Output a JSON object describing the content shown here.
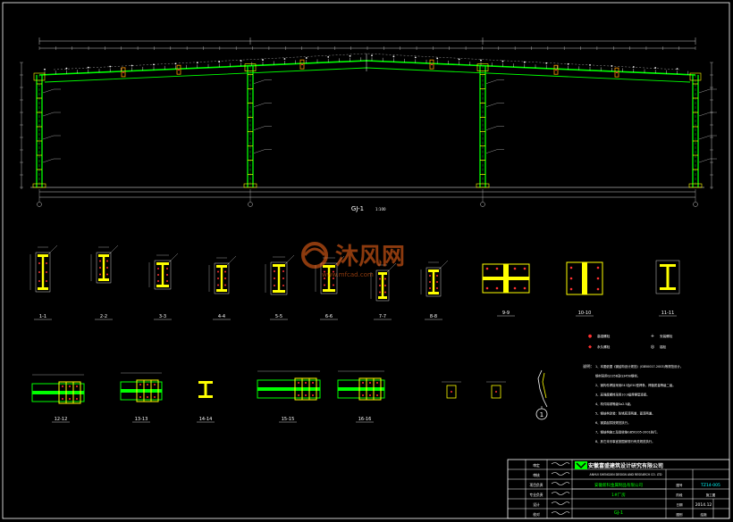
{
  "frame_title": "GJ-1",
  "frame_scale": "1:100",
  "section_labels": [
    "1-1",
    "2-2",
    "3-3",
    "4-4",
    "5-5",
    "6-6",
    "7-7",
    "8-8",
    "9-9",
    "10-10",
    "11-11",
    "12-12",
    "13-13",
    "14-14",
    "15-15",
    "16-16"
  ],
  "detail_callout": "1",
  "watermark": {
    "brand": "沐风网",
    "url": "www.mfcad.com"
  },
  "notes": {
    "heading": "说明：",
    "lines": [
      "1、本图依据《钢结构设计规范》(GB50017-2003)等规范设计。",
      "   钢材采用Q235B及Q345B钢材。",
      "2、钢构件焊接采用E43及E50型焊条，焊缝质量等级二级。",
      "3、高强度螺栓采用10.9级摩擦型连接。",
      "4、构件除锈等级Sa2.5级。",
      "5、钢结构涂装：防锈底漆两道，面漆两道。",
      "6、钢梁起拱按规范执行。",
      "7、钢结构施工及验收按GB50205-2001执行。",
      "8、其它未尽事宜按国家现行有关规范执行。"
    ]
  },
  "legend": [
    {
      "sym": "●",
      "text": "高强螺栓"
    },
    {
      "sym": "+",
      "text": "安装螺栓"
    },
    {
      "sym": "◆",
      "text": "永久螺栓"
    },
    {
      "sym": "◎",
      "text": "锚栓"
    }
  ],
  "title_block": {
    "company_cn": "安徽富盛建筑设计研究有限公司",
    "company_en": "ANHUI SHENGXIN DESIGN AND RESEARCH CO. LTD",
    "project": "安徽新科金属制品有限公司",
    "drawing": "1#厂房",
    "drawing_name": "GJ-1",
    "drawing_no_label": "图号",
    "drawing_no": "TZ14-005",
    "date_label": "日期",
    "date": "2014.12",
    "stage_label": "阶段",
    "stage": "施工图",
    "sheet_label": "图别",
    "sheet": "结施",
    "roles": [
      "审定",
      "审核",
      "项目负责",
      "专业负责",
      "设计",
      "校对"
    ]
  },
  "colors": {
    "background": "#000000",
    "green": "#00ff00",
    "yellow": "#ffff00",
    "white": "#ffffff",
    "cyan": "#00ffff",
    "red": "#ff3030",
    "orange": "#ff9900"
  }
}
